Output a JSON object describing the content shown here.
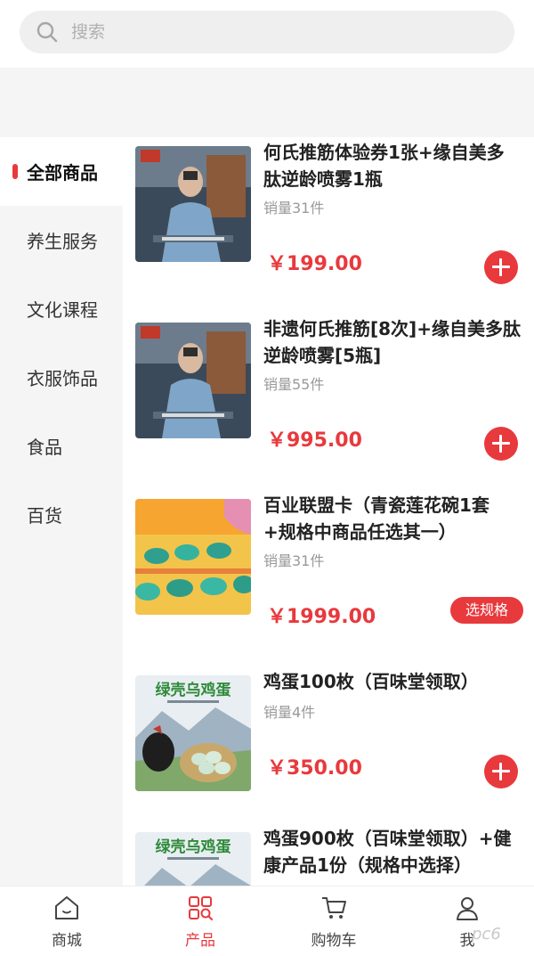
{
  "search": {
    "placeholder": "搜索",
    "icon": "search-icon"
  },
  "sidebar": {
    "items": [
      {
        "label": "全部商品",
        "active": true
      },
      {
        "label": "养生服务",
        "active": false
      },
      {
        "label": "文化课程",
        "active": false
      },
      {
        "label": "衣服饰品",
        "active": false
      },
      {
        "label": "食品",
        "active": false
      },
      {
        "label": "百货",
        "active": false
      }
    ]
  },
  "products": [
    {
      "title": "何氏推筋体验券1张+缘自美多肽逆龄喷雾1瓶",
      "sales": "销量31件",
      "price": "￥199.00",
      "action": "add"
    },
    {
      "title": "非遗何氏推筋[8次]+缘自美多肽逆龄喷雾[5瓶]",
      "sales": "销量55件",
      "price": "￥995.00",
      "action": "add"
    },
    {
      "title": "百业联盟卡（青瓷莲花碗1套+规格中商品任选其一）",
      "sales": "销量31件",
      "price": "￥1999.00",
      "action": "spec",
      "action_label": "选规格"
    },
    {
      "title": "鸡蛋100枚（百味堂领取）",
      "sales": "销量4件",
      "price": "￥350.00",
      "action": "add",
      "image_text": "绿壳乌鸡蛋"
    },
    {
      "title": "鸡蛋900枚（百味堂领取）+健康产品1份（规格中选择）",
      "image_text": "绿壳乌鸡蛋"
    }
  ],
  "tabbar": {
    "items": [
      {
        "label": "商城",
        "icon": "home-icon",
        "active": false
      },
      {
        "label": "产品",
        "icon": "grid-icon",
        "active": true
      },
      {
        "label": "购物车",
        "icon": "cart-icon",
        "active": false
      },
      {
        "label": "我",
        "icon": "user-icon",
        "active": false
      }
    ]
  },
  "watermark": "pc6",
  "colors": {
    "accent": "#e8393d",
    "sidebar_bg": "#f5f5f5",
    "text_muted": "#999999"
  }
}
